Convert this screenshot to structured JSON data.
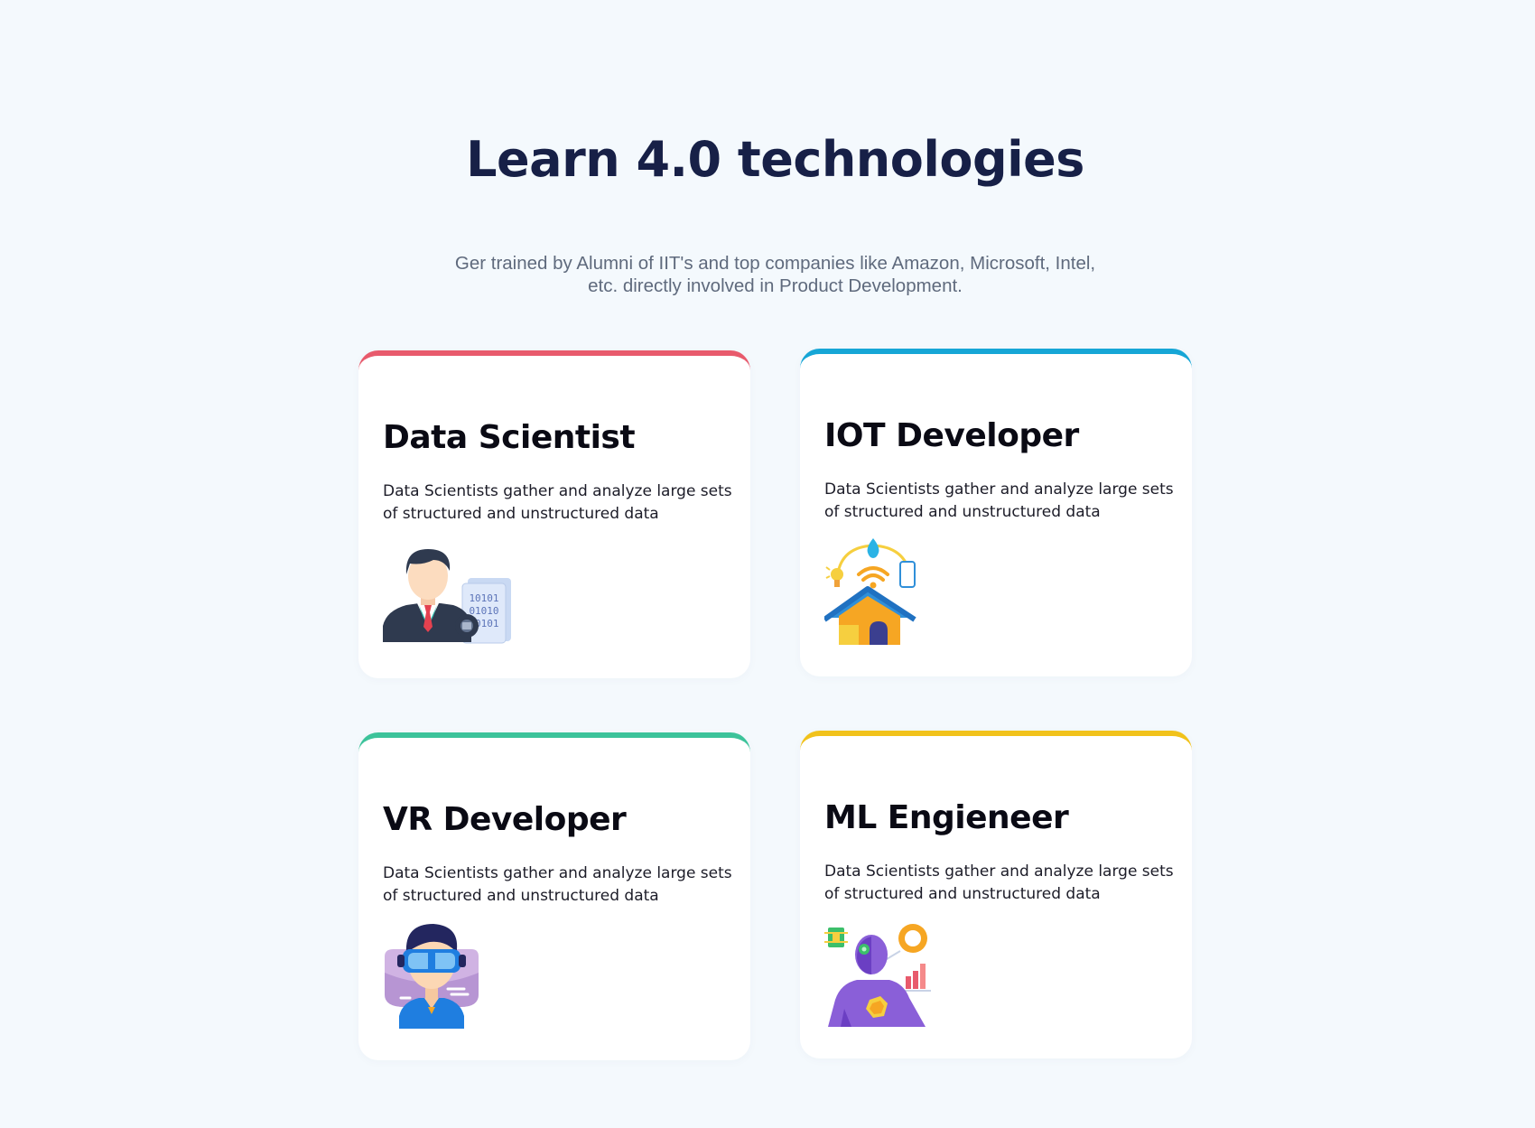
{
  "section": {
    "heading": "Learn 4.0 technologies",
    "subtext": "Ger trained by Alumni of IIT's and top companies like Amazon, Microsoft, Intel, etc. directly involved in Product Development."
  },
  "cards": [
    {
      "title": "Data Scientist",
      "description": "Data Scientists gather and analyze large sets of structured and unstructured data",
      "accent": "#e85a6c",
      "icon": "data-scientist-icon",
      "icon_text": [
        "10101",
        "01010",
        "10101"
      ]
    },
    {
      "title": "IOT Developer",
      "description": "Data Scientists gather and analyze large sets of structured and unstructured data",
      "accent": "#16a6d6",
      "icon": "smart-home-icon"
    },
    {
      "title": "VR Developer",
      "description": "Data Scientists gather and analyze large sets of structured and unstructured data",
      "accent": "#3cc39a",
      "icon": "vr-headset-person-icon"
    },
    {
      "title": "ML Engieneer",
      "description": "Data Scientists gather and analyze large sets of structured and unstructured data",
      "accent": "#f1c21b",
      "icon": "robot-ml-icon"
    }
  ]
}
